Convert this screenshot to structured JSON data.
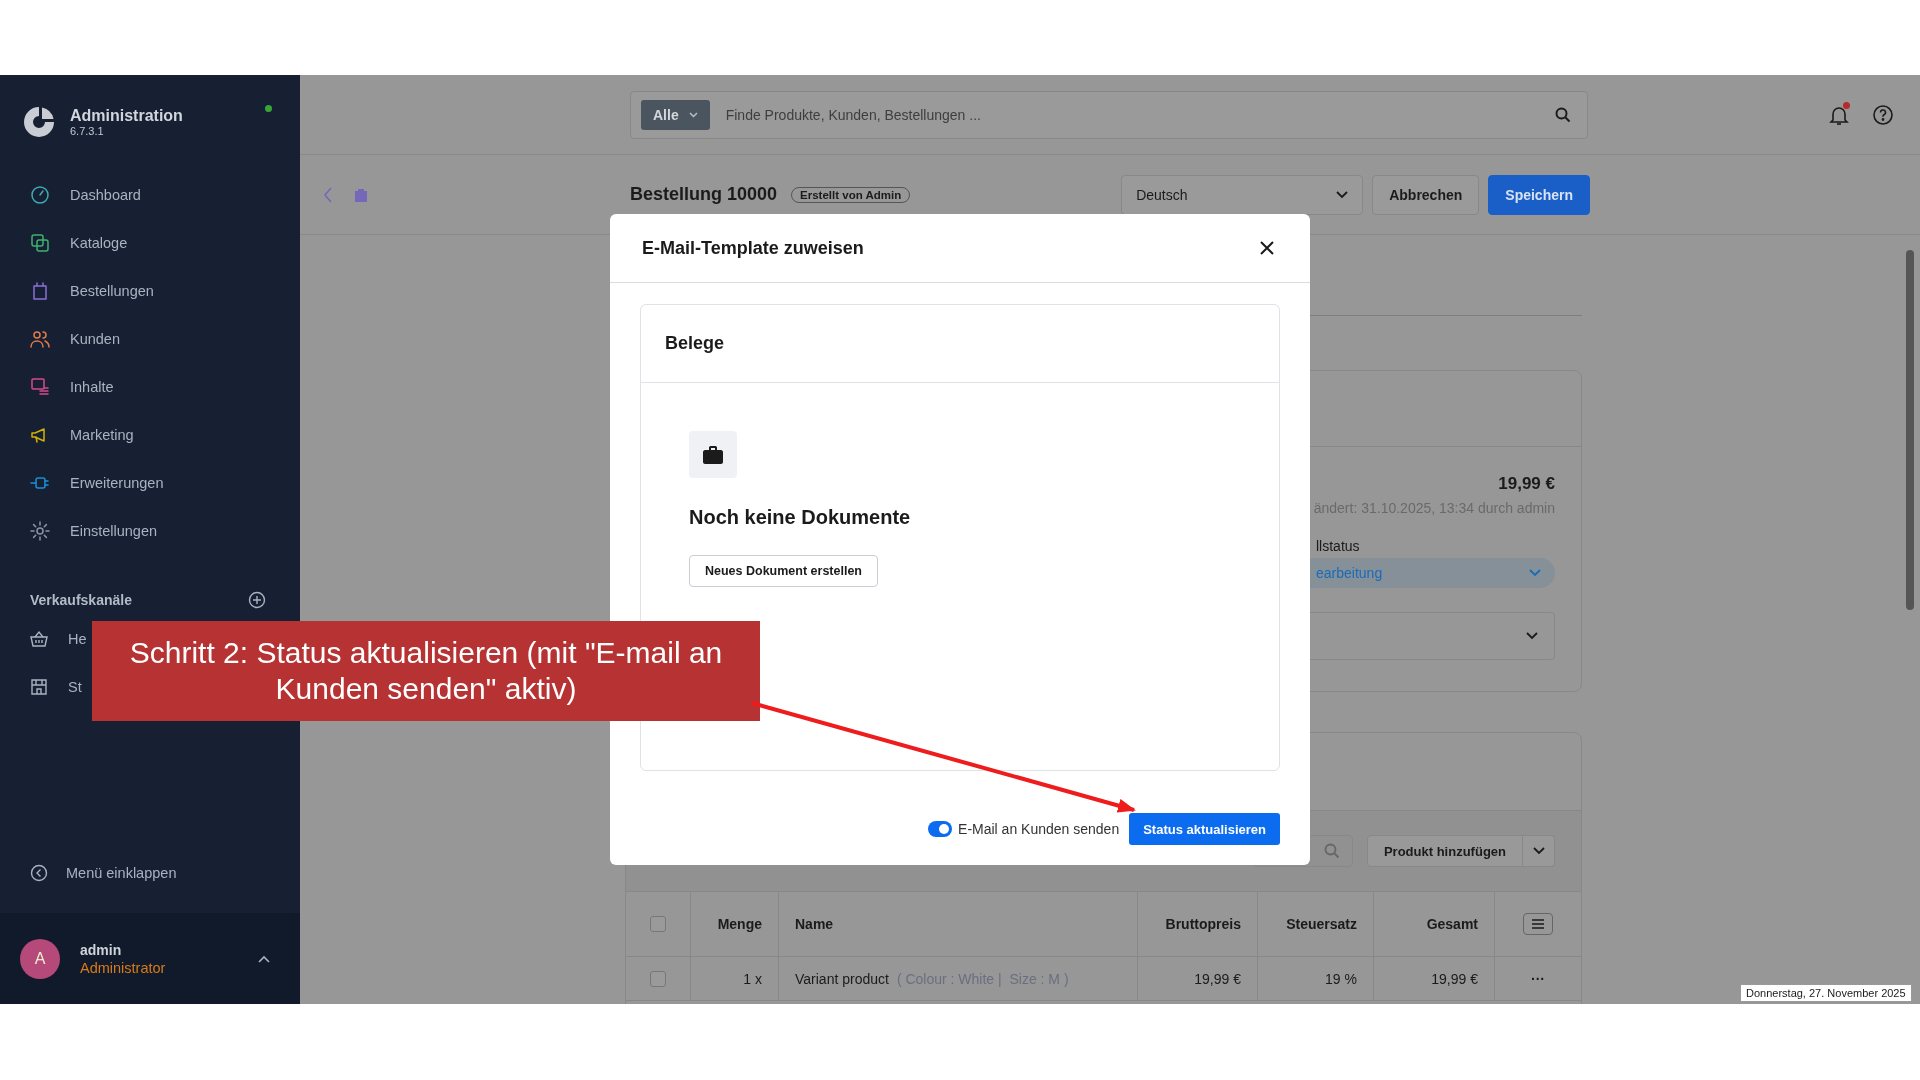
{
  "sidebar": {
    "title": "Administration",
    "version": "6.7.3.1",
    "online": true,
    "nav": [
      {
        "label": "Dashboard"
      },
      {
        "label": "Kataloge"
      },
      {
        "label": "Bestellungen"
      },
      {
        "label": "Kunden"
      },
      {
        "label": "Inhalte"
      },
      {
        "label": "Marketing"
      },
      {
        "label": "Erweiterungen"
      },
      {
        "label": "Einstellungen"
      }
    ],
    "section_title": "Verkaufskanäle",
    "channels": [
      {
        "label": "He"
      },
      {
        "label": "St"
      }
    ],
    "collapse_label": "Menü einklappen",
    "user": {
      "initial": "A",
      "name": "admin",
      "role": "Administrator"
    }
  },
  "topbar": {
    "search_scope": "Alle",
    "search_placeholder": "Finde Produkte, Kunden, Bestellungen ...",
    "notifications_unread": true
  },
  "header": {
    "title": "Bestellung 10000",
    "badge": "Erstellt von Admin",
    "language": "Deutsch",
    "buttons": [
      {
        "label": "Abbrechen",
        "kind": "secondary"
      },
      {
        "label": "Speichern",
        "kind": "primary"
      }
    ]
  },
  "order_card": {
    "amount": "19,99 €",
    "changed": "ändert: 31.10.2025, 13:34 durch admin",
    "status_label": "llstatus",
    "status_value": "earbeitung"
  },
  "products": {
    "add_button": "Produkt hinzufügen",
    "all_selected": false,
    "columns": [
      "Menge",
      "Name",
      "Bruttopreis",
      "Steuersatz",
      "Gesamt"
    ],
    "rows": [
      {
        "selected": false,
        "quantity": "1 x",
        "name": "Variant product",
        "options": "( Colour : White |  Size : M )",
        "price": "19,99 €",
        "tax": "19 %",
        "total": "19,99 €",
        "actions": "···"
      }
    ]
  },
  "modal": {
    "title": "E-Mail-Template zuweisen",
    "section_title": "Belege",
    "empty_text": "Noch keine Dokumente",
    "create_button": "Neues Dokument erstellen",
    "send_email": {
      "label": "E-Mail an Kunden senden",
      "on": true
    },
    "confirm_button": "Status aktualisieren"
  },
  "annotation": {
    "text": "Schritt 2: Status aktualisieren (mit \"E-mail an Kunden senden\" aktiv)"
  },
  "date_tooltip": "Donnerstag, 27. November 2025"
}
